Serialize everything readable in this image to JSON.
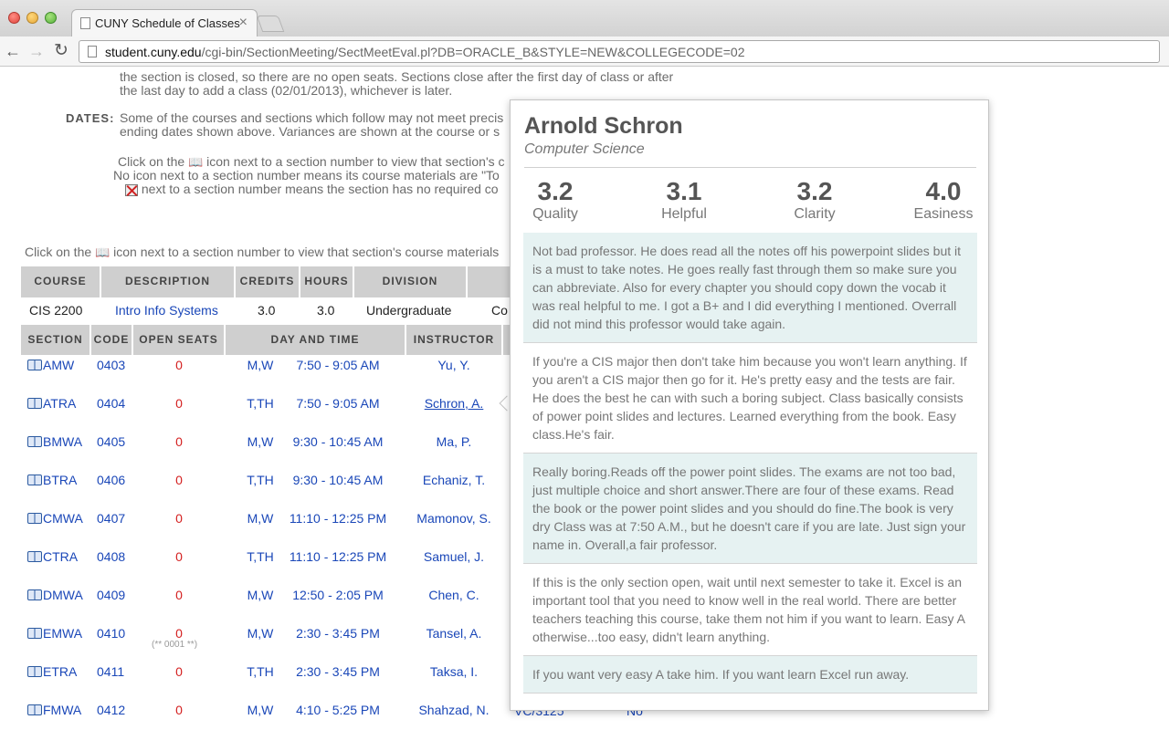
{
  "browser": {
    "tab_title": "CUNY Schedule of Classes",
    "tab_close": "×",
    "url_host": "student.cuny.edu",
    "url_path": "/cgi-bin/SectionMeeting/SectMeetEval.pl?DB=ORACLE_B&STYLE=NEW&COLLEGECODE=02",
    "back_icon": "←",
    "forward_icon": "→",
    "reload_icon": "↻"
  },
  "page": {
    "closed_note_line1": "the section is closed, so there are no open seats. Sections close after the first day of class or after",
    "closed_note_line2": "the last day to add a class (02/01/2013), whichever is later.",
    "dates_label": "DATES:",
    "dates_line1": "Some of the courses and sections which follow may not meet precis",
    "dates_line2": "ending dates shown above. Variances are shown at the course or s",
    "click_line_a": "Click on the",
    "click_line_b": "icon next to a section number to view that section's c",
    "noicon_line": "No icon next to a section number means its course materials are \"To",
    "nomaterials_line": "next to a section number means the section has no required co",
    "click_materials_a": "Click on the",
    "click_materials_b": "icon next to a section number to view that section's course materials",
    "book_glyph": "📖"
  },
  "course_table": {
    "headers": [
      "COURSE",
      "DESCRIPTION",
      "CREDITS",
      "HOURS",
      "DIVISION"
    ],
    "course": "CIS   2200",
    "description": "Intro Info Systems",
    "credits": "3.0",
    "hours": "3.0",
    "division": "Undergraduate",
    "extra": "Co"
  },
  "section_table": {
    "headers": [
      "SECTION",
      "CODE",
      "OPEN SEATS",
      "DAY AND TIME",
      "INSTRUCTOR"
    ],
    "rows": [
      {
        "section": "AMW",
        "code": "0403",
        "seats": "0",
        "day": "M,W",
        "time": "7:50 - 9:05 AM",
        "instructor": "Yu, Y."
      },
      {
        "section": "ATRA",
        "code": "0404",
        "seats": "0",
        "day": "T,TH",
        "time": "7:50 - 9:05 AM",
        "instructor": "Schron, A."
      },
      {
        "section": "BMWA",
        "code": "0405",
        "seats": "0",
        "day": "M,W",
        "time": "9:30 - 10:45 AM",
        "instructor": "Ma, P."
      },
      {
        "section": "BTRA",
        "code": "0406",
        "seats": "0",
        "day": "T,TH",
        "time": "9:30 - 10:45 AM",
        "instructor": "Echaniz, T."
      },
      {
        "section": "CMWA",
        "code": "0407",
        "seats": "0",
        "day": "M,W",
        "time": "11:10 - 12:25 PM",
        "instructor": "Mamonov, S."
      },
      {
        "section": "CTRA",
        "code": "0408",
        "seats": "0",
        "day": "T,TH",
        "time": "11:10 - 12:25 PM",
        "instructor": "Samuel, J."
      },
      {
        "section": "DMWA",
        "code": "0409",
        "seats": "0",
        "day": "M,W",
        "time": "12:50 - 2:05 PM",
        "instructor": "Chen, C."
      },
      {
        "section": "EMWA",
        "code": "0410",
        "seats": "0",
        "day": "M,W",
        "time": "2:30 - 3:45 PM",
        "instructor": "Tansel, A."
      },
      {
        "section": "ETRA",
        "code": "0411",
        "seats": "0",
        "day": "T,TH",
        "time": "2:30 - 3:45 PM",
        "instructor": "Taksa, I."
      },
      {
        "section": "FMWA",
        "code": "0412",
        "seats": "0",
        "day": "M,W",
        "time": "4:10 - 5:25 PM",
        "instructor": "Shahzad, N."
      }
    ],
    "row_note": "(** 0001 **)",
    "partial_room": "VC/3125",
    "partial_no": "No"
  },
  "popup": {
    "name": "Arnold Schron",
    "department": "Computer Science",
    "metrics": [
      {
        "value": "3.2",
        "label": "Quality"
      },
      {
        "value": "3.1",
        "label": "Helpful"
      },
      {
        "value": "3.2",
        "label": "Clarity"
      },
      {
        "value": "4.0",
        "label": "Easiness"
      }
    ],
    "comments": [
      "Not bad professor. He does read all the notes off his powerpoint slides but it is a must to take notes. He goes really fast through them so make sure you can abbreviate. Also for every chapter you should copy down the vocab it was real helpful to me. I got a B+ and I did everything I mentioned. Overrall did not mind this professor would take again.",
      "If you're a CIS major then don't take him because you won't learn anything. If you aren't a CIS major then go for it. He's pretty easy and the tests are fair. He does the best he can with such a boring subject. Class basically consists of power point slides and lectures. Learned everything from the book. Easy class.He's fair.",
      "Really boring.Reads off the power point slides. The exams are not too bad, just multiple choice and short answer.There are four of these exams. Read the book or the power point slides and you should do fine.The book is very dry Class was at 7:50 A.M., but he doesn't care if you are late. Just sign your name in. Overall,a fair professor.",
      "If this is the only section open, wait until next semester to take it. Excel is an important tool that you need to know well in the real world. There are better teachers teaching this course, take them not him if you want to learn. Easy A otherwise...too easy, didn't learn anything.",
      "If you want very easy A take him. If you want learn Excel run away."
    ]
  }
}
